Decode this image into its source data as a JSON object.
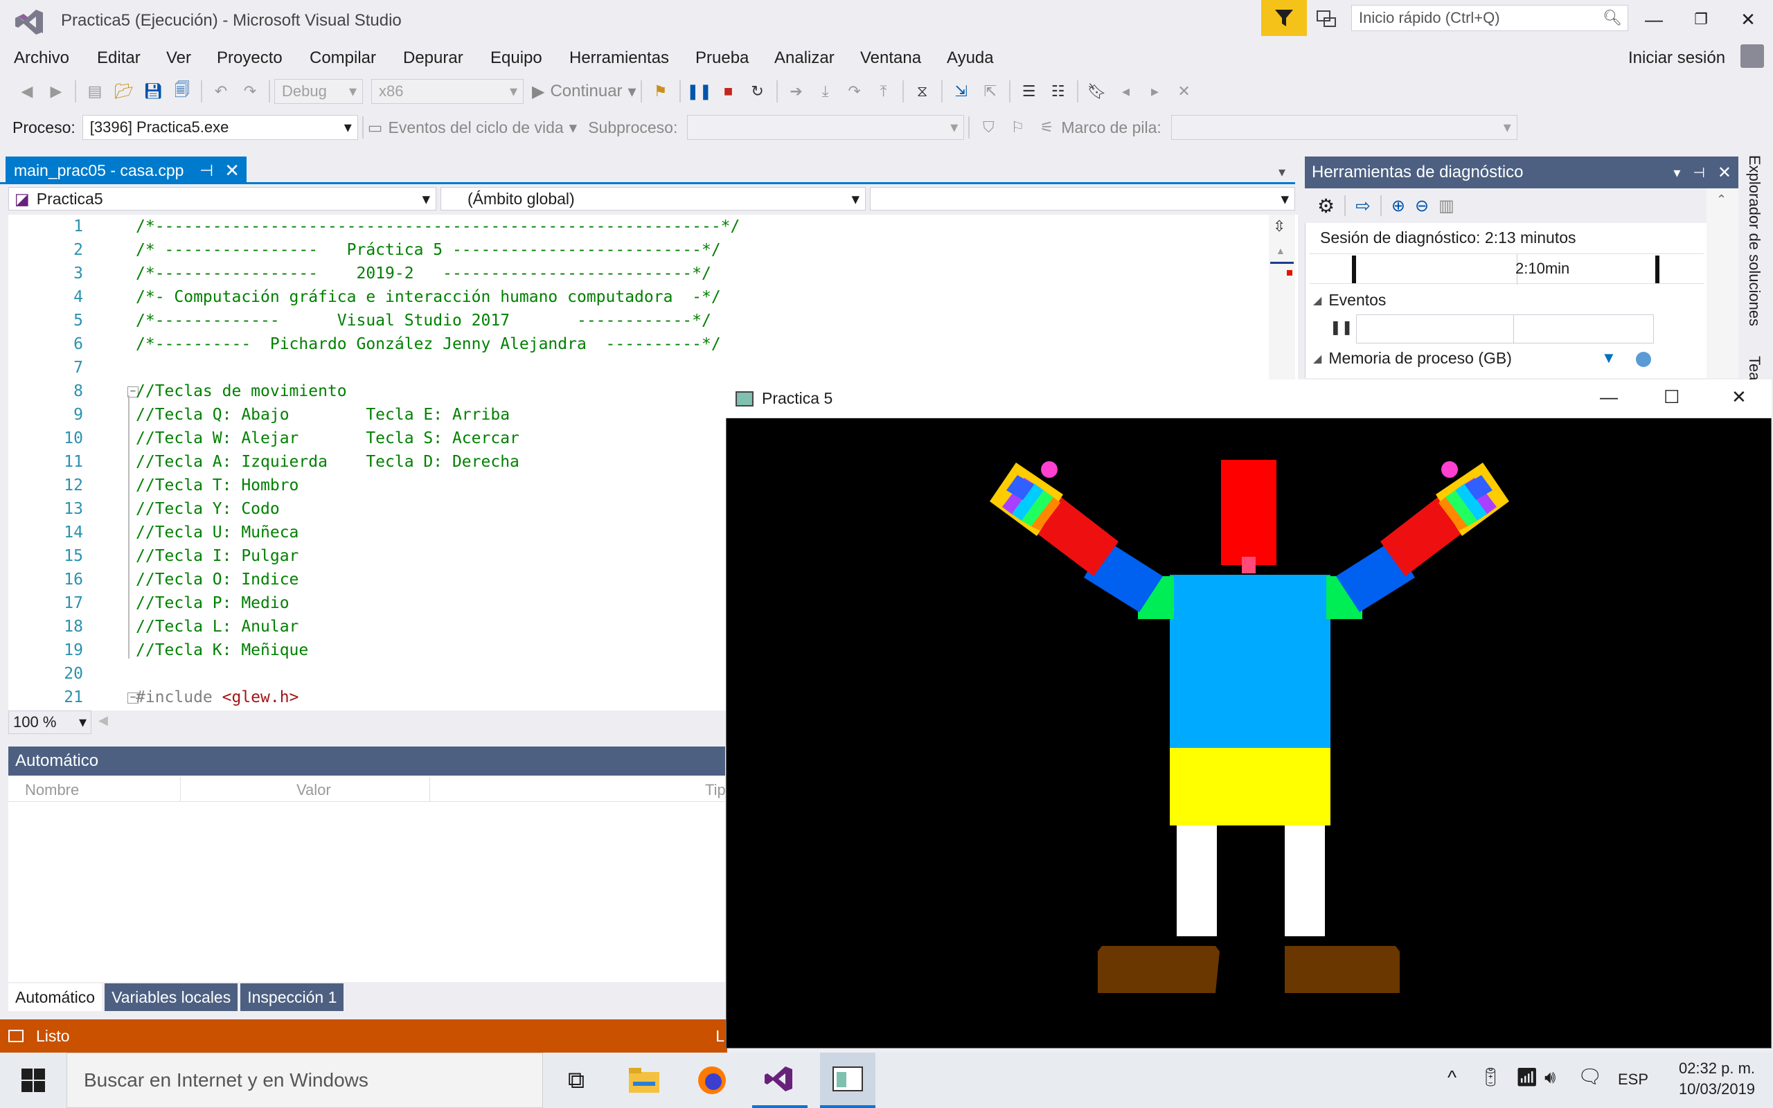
{
  "window": {
    "title": "Practica5 (Ejecución) - Microsoft Visual Studio",
    "quick_launch_placeholder": "Inicio rápido (Ctrl+Q)",
    "sign_in": "Iniciar sesión"
  },
  "menu": [
    "Archivo",
    "Editar",
    "Ver",
    "Proyecto",
    "Compilar",
    "Depurar",
    "Equipo",
    "Herramientas",
    "Prueba",
    "Analizar",
    "Ventana",
    "Ayuda"
  ],
  "toolbar": {
    "config": "Debug",
    "platform": "x86",
    "continue_label": "Continuar",
    "process_label": "Proceso:",
    "process_value": "[3396] Practica5.exe",
    "lifecycle_label": "Eventos del ciclo de vida",
    "thread_label": "Subproceso:",
    "stack_label": "Marco de pila:"
  },
  "editor": {
    "tab": "main_prac05 - casa.cpp",
    "nav_project": "Practica5",
    "nav_scope": "(Ámbito global)",
    "zoom": "100 %",
    "lines": [
      {
        "n": "1",
        "t": "/*-----------------------------------------------------------*/"
      },
      {
        "n": "2",
        "t": "/* ----------------   Práctica 5 --------------------------*/"
      },
      {
        "n": "3",
        "t": "/*-----------------    2019-2   --------------------------*/"
      },
      {
        "n": "4",
        "t": "/*- Computación gráfica e interacción humano computadora  -*/"
      },
      {
        "n": "5",
        "t": "/*-------------      Visual Studio 2017       ------------*/"
      },
      {
        "n": "6",
        "t": "/*----------  Pichardo González Jenny Alejandra  ----------*/"
      },
      {
        "n": "7",
        "t": ""
      },
      {
        "n": "8",
        "t": "//Teclas de movimiento"
      },
      {
        "n": "9",
        "t": "//Tecla Q: Abajo        Tecla E: Arriba"
      },
      {
        "n": "10",
        "t": "//Tecla W: Alejar       Tecla S: Acercar"
      },
      {
        "n": "11",
        "t": "//Tecla A: Izquierda    Tecla D: Derecha"
      },
      {
        "n": "12",
        "t": "//Tecla T: Hombro"
      },
      {
        "n": "13",
        "t": "//Tecla Y: Codo"
      },
      {
        "n": "14",
        "t": "//Tecla U: Muñeca"
      },
      {
        "n": "15",
        "t": "//Tecla I: Pulgar"
      },
      {
        "n": "16",
        "t": "//Tecla O: Indice"
      },
      {
        "n": "17",
        "t": "//Tecla P: Medio"
      },
      {
        "n": "18",
        "t": "//Tecla L: Anular"
      },
      {
        "n": "19",
        "t": "//Tecla K: Meñique"
      },
      {
        "n": "20",
        "t": ""
      },
      {
        "n": "21",
        "t": "#include ",
        "inc": "<glew.h>"
      }
    ]
  },
  "autos": {
    "title": "Automático",
    "col_name": "Nombre",
    "col_value": "Valor",
    "col_type": "Tip",
    "tabs": [
      "Automático",
      "Variables locales",
      "Inspección 1"
    ]
  },
  "status": {
    "text": "Listo",
    "right": "L"
  },
  "diagnostics": {
    "title": "Herramientas de diagnóstico",
    "session": "Sesión de diagnóstico: 2:13 minutos",
    "time_tick": "2:10min",
    "events": "Eventos",
    "memory": "Memoria de proceso (GB)"
  },
  "solution_explorer": "Explorador de soluciones",
  "team_tab": "Tea",
  "app_window": {
    "title": "Practica 5"
  },
  "taskbar": {
    "search_placeholder": "Buscar en Internet y en Windows",
    "lang": "ESP",
    "time": "02:32 p. m.",
    "date": "10/03/2019"
  },
  "colors": {
    "vs_blue": "#007acc",
    "status_orange": "#ca5100",
    "panel_header": "#4d6082",
    "comment_green": "#008000",
    "line_number": "#2b91af"
  }
}
